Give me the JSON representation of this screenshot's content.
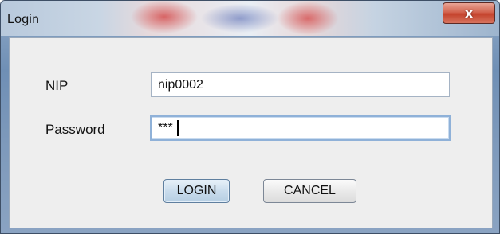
{
  "window": {
    "title": "Login",
    "close_label": "x"
  },
  "form": {
    "nip_label": "NIP",
    "nip_value": "nip0002",
    "password_label": "Password",
    "password_value": "***"
  },
  "buttons": {
    "login_label": "LOGIN",
    "cancel_label": "CANCEL"
  },
  "colors": {
    "close_button": "#c4432c",
    "dialog_background": "#eeeeee",
    "focus_border": "#8fb1d8"
  }
}
